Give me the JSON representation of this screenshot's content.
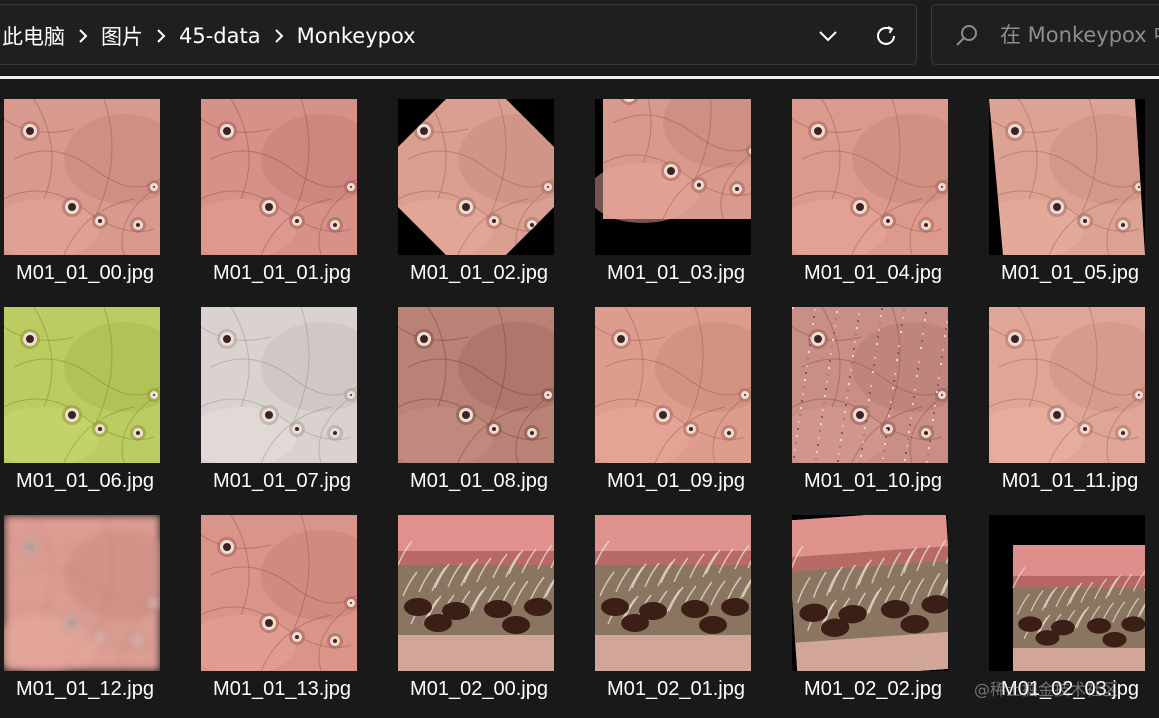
{
  "address_bar": {
    "breadcrumbs": [
      "此电脑",
      "图片",
      "45-data",
      "Monkeypox"
    ],
    "separator_icon": "chevron-right-icon",
    "history_button_icon": "chevron-down-icon",
    "refresh_button_icon": "refresh-icon"
  },
  "search": {
    "placeholder": "在 Monkeypox 中搜索",
    "icon": "search-icon"
  },
  "files": [
    {
      "name": "M01_01_00.jpg",
      "variant": "lesion",
      "tone": "#d8998e",
      "transform": "none"
    },
    {
      "name": "M01_01_01.jpg",
      "variant": "lesion",
      "tone": "#d69189",
      "transform": "none"
    },
    {
      "name": "M01_01_02.jpg",
      "variant": "lesion",
      "tone": "#db9f92",
      "transform": "rotate45"
    },
    {
      "name": "M01_01_03.jpg",
      "variant": "lesion",
      "tone": "#d9998d",
      "transform": "shift"
    },
    {
      "name": "M01_01_04.jpg",
      "variant": "lesion",
      "tone": "#db9a8d",
      "transform": "none"
    },
    {
      "name": "M01_01_05.jpg",
      "variant": "lesion",
      "tone": "#dca294",
      "transform": "skew"
    },
    {
      "name": "M01_01_06.jpg",
      "variant": "lesion",
      "tone": "#bccb62",
      "transform": "none"
    },
    {
      "name": "M01_01_07.jpg",
      "variant": "lesion",
      "tone": "#d9d2cf",
      "transform": "none"
    },
    {
      "name": "M01_01_08.jpg",
      "variant": "lesion",
      "tone": "#b98276",
      "transform": "none"
    },
    {
      "name": "M01_01_09.jpg",
      "variant": "lesion",
      "tone": "#dd9c8e",
      "transform": "none"
    },
    {
      "name": "M01_01_10.jpg",
      "variant": "lesion",
      "tone": "#c98f86",
      "transform": "noise"
    },
    {
      "name": "M01_01_11.jpg",
      "variant": "lesion",
      "tone": "#dfa597",
      "transform": "none"
    },
    {
      "name": "M01_01_12.jpg",
      "variant": "lesion",
      "tone": "#dc9d93",
      "transform": "blur"
    },
    {
      "name": "M01_01_13.jpg",
      "variant": "lesion",
      "tone": "#d9958a",
      "transform": "none"
    },
    {
      "name": "M01_02_00.jpg",
      "variant": "lip",
      "tone": "#e0908d",
      "transform": "none"
    },
    {
      "name": "M01_02_01.jpg",
      "variant": "lip",
      "tone": "#e0928e",
      "transform": "none"
    },
    {
      "name": "M01_02_02.jpg",
      "variant": "lip",
      "tone": "#df918c",
      "transform": "tilt"
    },
    {
      "name": "M01_02_03.jpg",
      "variant": "lip",
      "tone": "#de8f8b",
      "transform": "shrink"
    }
  ],
  "watermark": "@稀土掘金技术社区"
}
